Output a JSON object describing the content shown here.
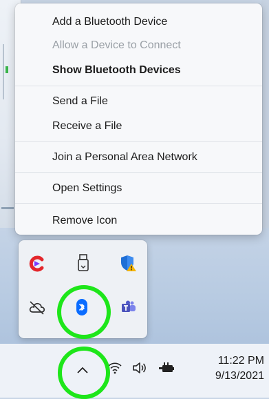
{
  "context_menu": {
    "items": [
      {
        "label": "Add a Bluetooth Device",
        "state": "normal"
      },
      {
        "label": "Allow a Device to Connect",
        "state": "disabled"
      },
      {
        "label": "Show Bluetooth Devices",
        "state": "bold"
      },
      {
        "label": "Send a File",
        "state": "normal"
      },
      {
        "label": "Receive a File",
        "state": "normal"
      },
      {
        "label": "Join a Personal Area Network",
        "state": "normal"
      },
      {
        "label": "Open Settings",
        "state": "normal"
      },
      {
        "label": "Remove Icon",
        "state": "normal"
      }
    ]
  },
  "tray_flyout": {
    "icons": [
      "app-c-icon",
      "usb-drive-icon",
      "security-warning-icon",
      "onedrive-offline-icon",
      "bluetooth-icon",
      "teams-icon"
    ]
  },
  "taskbar": {
    "icons": [
      "chevron-up-icon",
      "wifi-icon",
      "speaker-icon",
      "battery-icon"
    ],
    "time": "11:22 PM",
    "date": "9/13/2021"
  },
  "colors": {
    "highlight_ring": "#1ee61a",
    "bluetooth_blue": "#0a6cff",
    "menu_background": "#f7f8fa",
    "disabled_text": "#9aa0a6"
  }
}
